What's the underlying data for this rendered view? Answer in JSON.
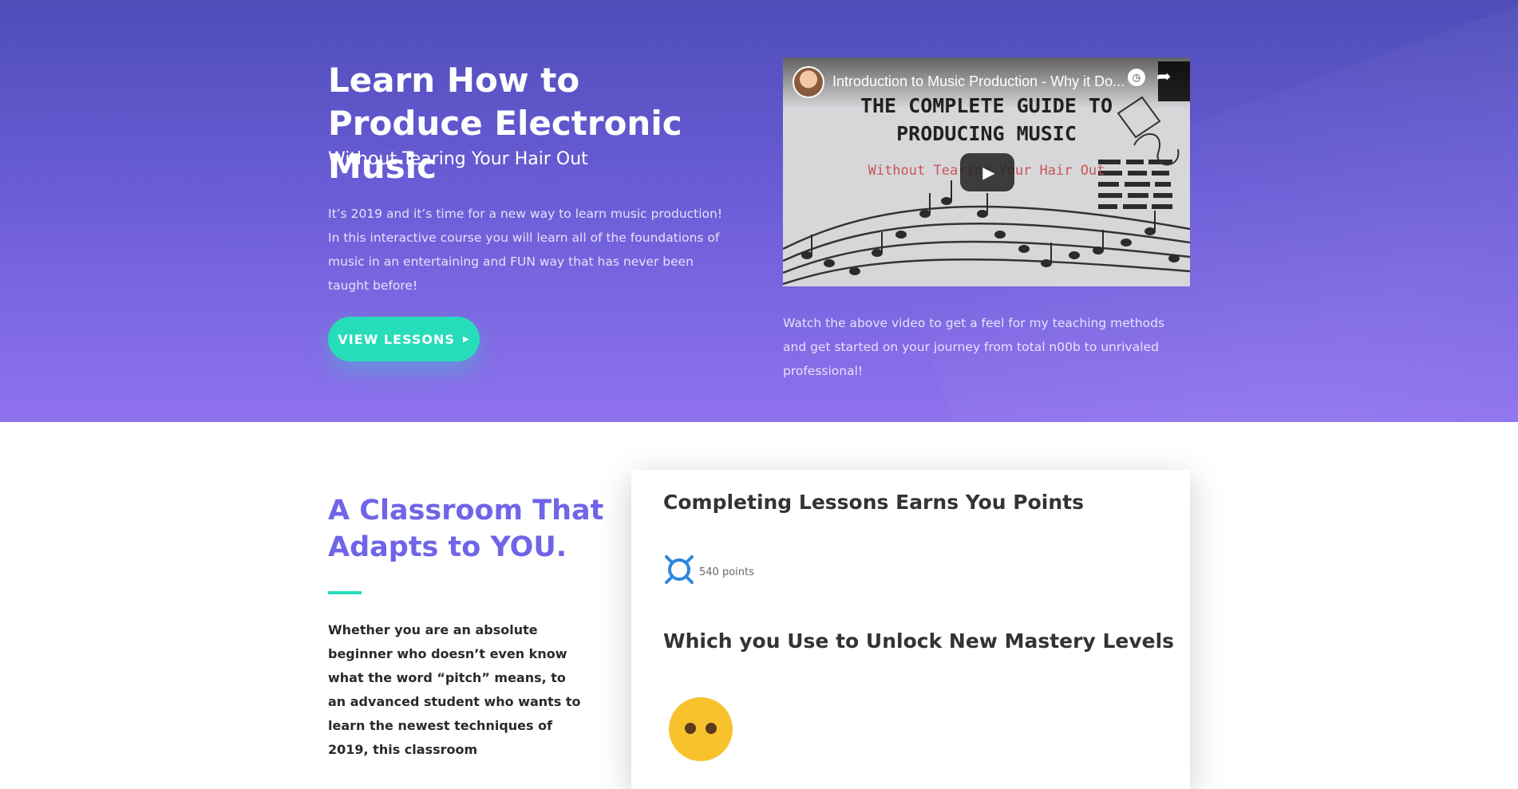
{
  "hero": {
    "title": "Learn How to Produce Electronic Music",
    "subtitle": "Without Tearing Your Hair Out",
    "body": "It’s 2019 and it’s time for a new way to learn music production! In this interactive course you will learn all of the foundations of music in an entertaining and FUN way that has never been taught before!",
    "cta_label": "VIEW LESSONS",
    "cta_icon": "caret-right-icon"
  },
  "video": {
    "title": "Introduction to Music Production - Why it Do...",
    "thumbnail_heading": "THE COMPLETE GUIDE TO PRODUCING MUSIC",
    "thumbnail_tagline": "Without Tearing Your Hair Out",
    "caption": "Watch the above video to get a feel for my teaching methods and get started on your journey from total n00b to unrivaled professional!"
  },
  "classroom": {
    "title": "A Classroom That Adapts to YOU.",
    "body": "Whether you are an absolute beginner who doesn’t even know what the word “pitch” means, to an advanced student who wants to learn the newest techniques of 2019, this classroom"
  },
  "card": {
    "heading_points": "Completing Lessons Earns You Points",
    "points_label": "540 points",
    "heading_levels": "Which you Use to Unlock New Mastery Levels"
  },
  "colors": {
    "accent": "#27ddb9",
    "heading_purple": "#7064e8",
    "hero_top": "#4e4db8",
    "hero_bottom": "#8f72ee"
  }
}
